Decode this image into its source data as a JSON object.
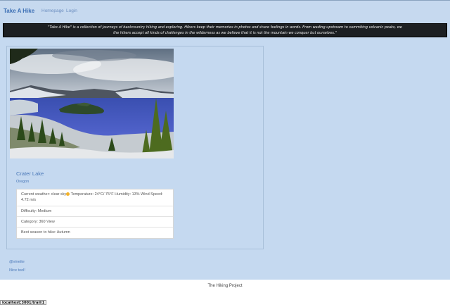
{
  "nav": {
    "brand": "Take A Hike",
    "links": [
      "Homepage",
      "Login"
    ]
  },
  "intro": {
    "line1": "\"Take A Hike\" is a collection of journeys of backcountry hiking and exploring. Hikers keep their memories in photos and share feelings in words. From wading upstream to summiting volcanic peaks, we",
    "line2": "the hikers accept all kinds of challenges in the wilderness as we believe that it is not the mountain we conquer but ourselves.\""
  },
  "trail": {
    "name": "Crater Lake",
    "state": "Oregon",
    "weather": {
      "prefix": "Current weather: clear sky",
      "icon": "sun-icon",
      "details": " Temperature: 24°C/ 75°F Humidity: 13% Wind Speed: 4.72 m/s"
    },
    "difficulty": "Difficulty: Medium",
    "category": "Category: 360 View",
    "season": "Best season to hike: Autumn"
  },
  "comment": {
    "user": "@vinette",
    "text": "Nice tool!"
  },
  "footer": {
    "text": "The Hiking Project"
  },
  "status_bar": {
    "url": "localhost:3001/trail/1"
  },
  "colors": {
    "page_background": "#c5d9f0",
    "accent": "#4a78b8",
    "banner": "#1c1f22"
  }
}
